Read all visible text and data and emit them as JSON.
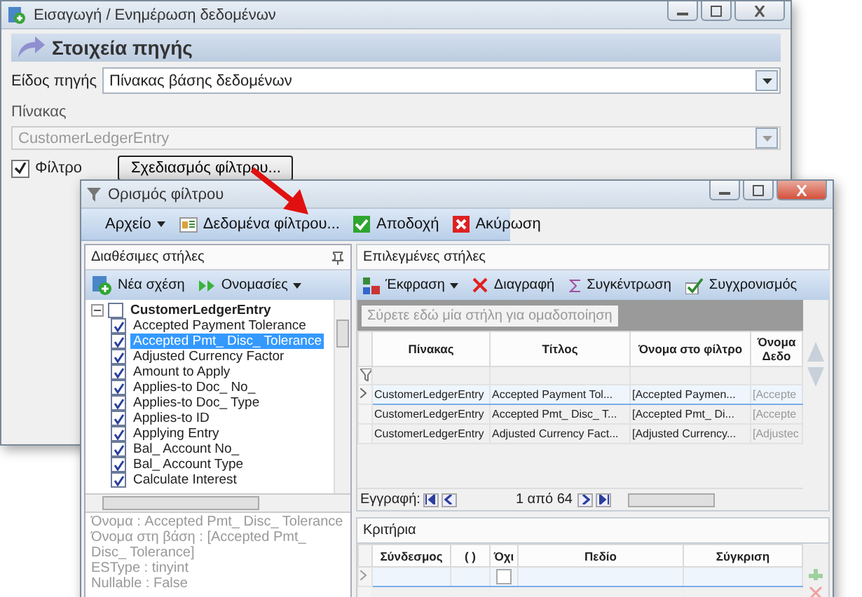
{
  "main_window": {
    "title": "Εισαγωγή / Ενημέρωση δεδομένων",
    "section_title": "Στοιχεία πηγής",
    "source_type": {
      "label": "Είδος πηγής",
      "value": "Πίνακας βάσης δεδομένων"
    },
    "table": {
      "label": "Πίνακας",
      "value": "CustomerLedgerEntry",
      "disabled": true
    },
    "filter": {
      "label": "Φίλτρο",
      "checked": true
    },
    "filter_design_button": "Σχεδιασμός φίλτρου..."
  },
  "filter_dialog": {
    "title": "Ορισμός φίλτρου",
    "toolbar": [
      {
        "label": "Αρχείο",
        "kind": "menu"
      },
      {
        "label": "Δεδομένα φίλτρου...",
        "kind": "data"
      },
      {
        "label": "Αποδοχή",
        "kind": "accept"
      },
      {
        "label": "Ακύρωση",
        "kind": "cancel"
      }
    ],
    "available_columns": {
      "title": "Διαθέσιμες στήλες",
      "toolbar": [
        {
          "label": "Νέα σχέση",
          "kind": "new"
        },
        {
          "label": "Ονομασίες",
          "kind": "names"
        }
      ],
      "tree": [
        {
          "label": "CustomerLedgerEntry",
          "checked": false,
          "expanded": true,
          "children": [
            {
              "label": "Accepted Payment Tolerance",
              "checked": true,
              "selected": false
            },
            {
              "label": "Accepted Pmt_ Disc_ Tolerance",
              "checked": true,
              "selected": true
            },
            {
              "label": "Adjusted Currency Factor",
              "checked": true,
              "selected": false
            },
            {
              "label": "Amount to Apply",
              "checked": true,
              "selected": false
            },
            {
              "label": "Applies-to Doc_ No_",
              "checked": true,
              "selected": false
            },
            {
              "label": "Applies-to Doc_ Type",
              "checked": true,
              "selected": false
            },
            {
              "label": "Applies-to ID",
              "checked": true,
              "selected": false
            },
            {
              "label": "Applying Entry",
              "checked": true,
              "selected": false
            },
            {
              "label": "Bal_ Account No_",
              "checked": true,
              "selected": false
            },
            {
              "label": "Bal_ Account Type",
              "checked": true,
              "selected": false
            },
            {
              "label": "Calculate Interest",
              "checked": true,
              "selected": false
            }
          ]
        }
      ],
      "info": [
        "Όνομα : Accepted Pmt_ Disc_ Tolerance",
        "Όνομα στη βάση : [Accepted Pmt_ Disc_ Tolerance]",
        "ESType : tinyint",
        "Nullable : False"
      ]
    },
    "selected_columns": {
      "title": "Επιλεγμένες στήλες",
      "toolbar": [
        {
          "label": "Έκφραση",
          "kind": "expression"
        },
        {
          "label": "Διαγραφή",
          "kind": "delete"
        },
        {
          "label": "Συγκέντρωση",
          "kind": "sum"
        },
        {
          "label": "Συγχρονισμός",
          "kind": "sync"
        }
      ],
      "group_placeholder": "Σύρετε εδώ μία στήλη για ομαδοποίηση",
      "columns": [
        "Πίνακας",
        "Τίτλος",
        "Όνομα στο φίλτρο",
        "Όνομα Δεδο"
      ],
      "rows": [
        {
          "cells": [
            "CustomerLedgerEntry",
            "Accepted Payment Tol...",
            "[Accepted Paymen...",
            "[Accepte"
          ],
          "selected": true
        },
        {
          "cells": [
            "CustomerLedgerEntry",
            "Accepted Pmt_ Disc_ T...",
            "[Accepted Pmt_ Di...",
            "[Accepte"
          ],
          "selected": false
        },
        {
          "cells": [
            "CustomerLedgerEntry",
            "Adjusted Currency Fact...",
            "[Adjusted Currency...",
            "[Adjustec"
          ],
          "selected": false
        }
      ],
      "navigator": {
        "label": "Εγγραφή:",
        "position": "1 από 64"
      }
    },
    "criteria": {
      "title": "Κριτήρια",
      "columns": [
        "Σύνδεσμος",
        "( )",
        "Όχι",
        "Πεδίο",
        "Σύγκριση"
      ],
      "rows": [
        {
          "not": false,
          "selected": true
        }
      ]
    }
  }
}
